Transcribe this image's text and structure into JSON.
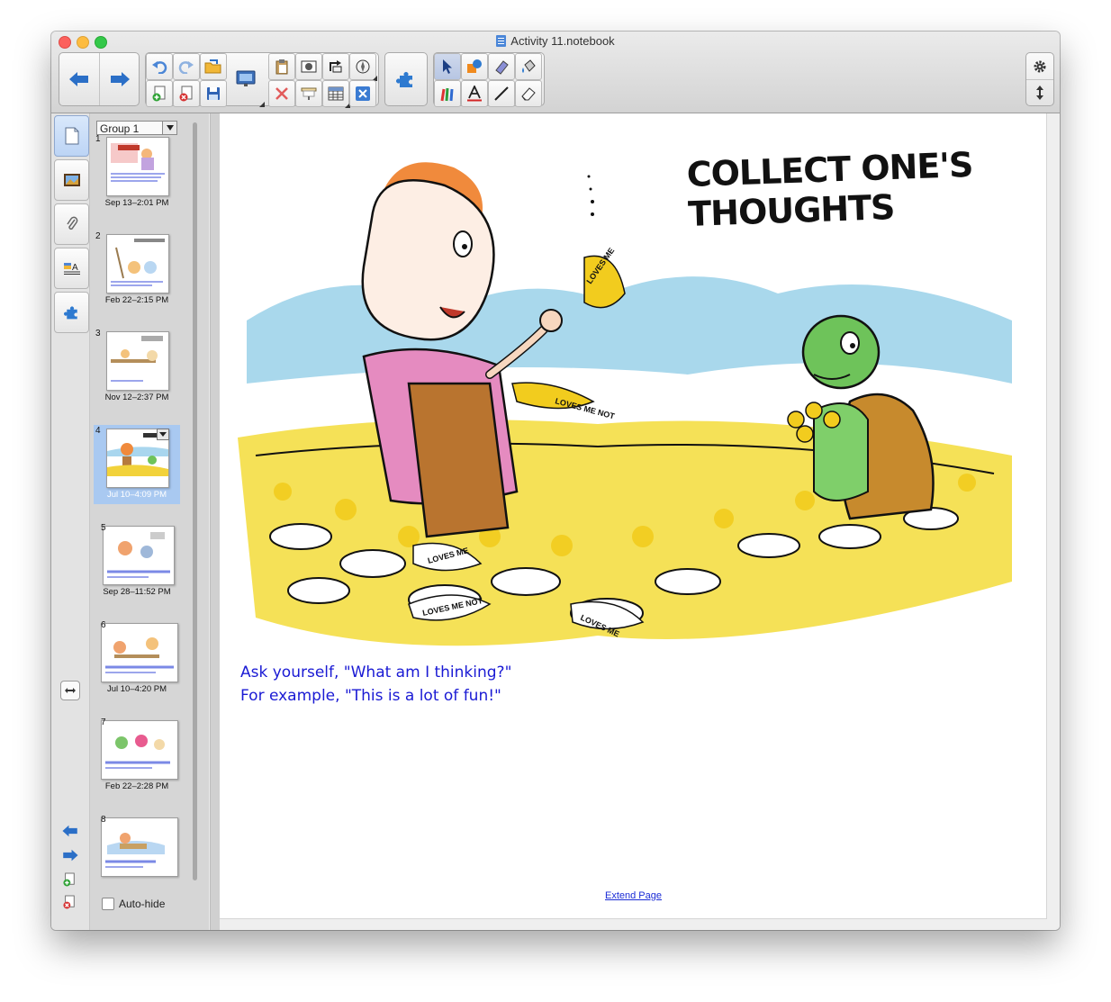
{
  "window": {
    "title": "Activity 11.notebook"
  },
  "toolbar": {
    "left_items": [
      "back-arrow",
      "forward-arrow"
    ],
    "tooltips": {}
  },
  "sorter": {
    "group": "Group 1",
    "pages": [
      {
        "num": "1",
        "date": "Sep 13–2:01 PM"
      },
      {
        "num": "2",
        "date": "Feb 22–2:15 PM"
      },
      {
        "num": "3",
        "date": "Nov 12–2:37 PM"
      },
      {
        "num": "4",
        "date": "Jul 10–4:09 PM"
      },
      {
        "num": "5",
        "date": "Sep 28–11:52 PM"
      },
      {
        "num": "6",
        "date": "Jul 10–4:20 PM"
      },
      {
        "num": "7",
        "date": "Feb 22–2:28 PM"
      },
      {
        "num": "8",
        "date": ""
      }
    ],
    "selected_index": 3,
    "autohide_label": "Auto-hide"
  },
  "page": {
    "art_title": "COLLECT ONE'S THOUGHTS",
    "flower_labels": [
      "LOVES ME",
      "LOVES ME NOT",
      "LOVES ME",
      "LOVES ME NOT",
      "LOVES ME"
    ],
    "caption_line1": "Ask yourself, \"What am I thinking?\"",
    "caption_line2": "For example, \"This is a lot of fun!\"",
    "extend_link": "Extend Page"
  },
  "colors": {
    "accent": "#1a1ad4",
    "selection": "#a9c9f1",
    "link": "#1a2bd6"
  }
}
